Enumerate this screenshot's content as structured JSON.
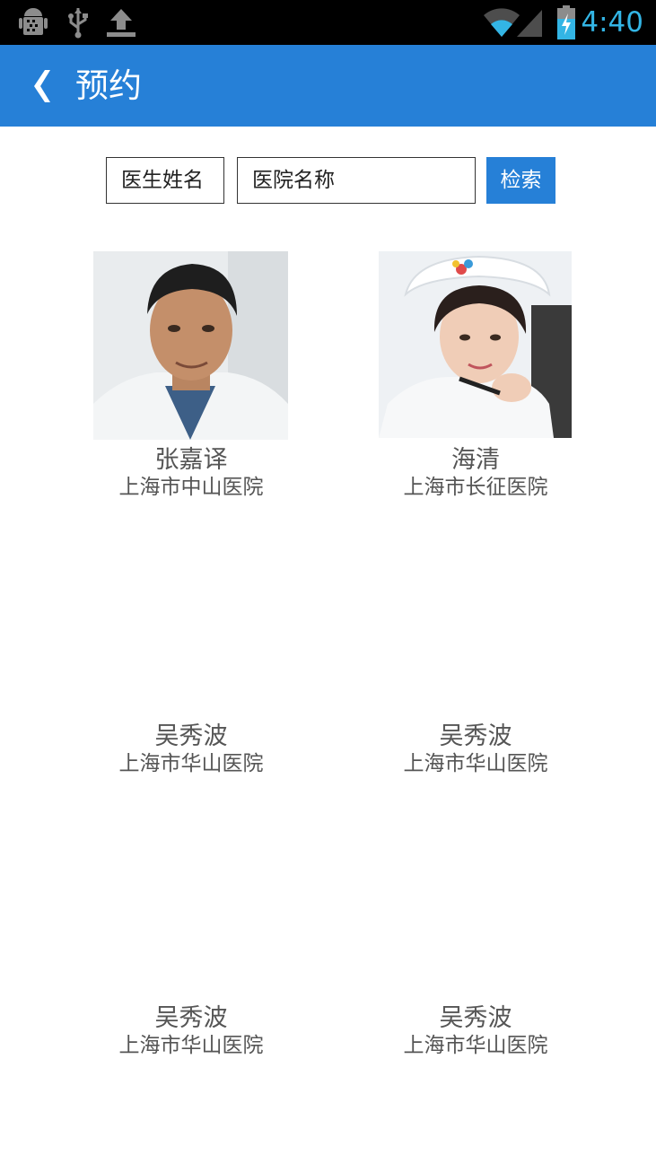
{
  "status_bar": {
    "time": "4:40",
    "icons": [
      "android-debug-icon",
      "usb-icon",
      "upload-icon",
      "wifi-icon",
      "signal-icon",
      "battery-charging-icon"
    ]
  },
  "action_bar": {
    "title": "预约",
    "back_icon": "chevron-left-icon"
  },
  "search": {
    "doctor_placeholder": "医生姓名",
    "hospital_placeholder": "医院名称",
    "button_label": "检索"
  },
  "doctors": [
    {
      "name": "张嘉译",
      "hospital": "上海市中山医院",
      "has_photo": true
    },
    {
      "name": "海清",
      "hospital": "上海市长征医院",
      "has_photo": true
    },
    {
      "name": "吴秀波",
      "hospital": "上海市华山医院",
      "has_photo": false
    },
    {
      "name": "吴秀波",
      "hospital": "上海市华山医院",
      "has_photo": false
    },
    {
      "name": "吴秀波",
      "hospital": "上海市华山医院",
      "has_photo": false
    },
    {
      "name": "吴秀波",
      "hospital": "上海市华山医院",
      "has_photo": false
    }
  ],
  "colors": {
    "action_bar": "#2680d7",
    "status_bar": "#000000",
    "clock": "#33b5e5",
    "text": "#555555"
  }
}
